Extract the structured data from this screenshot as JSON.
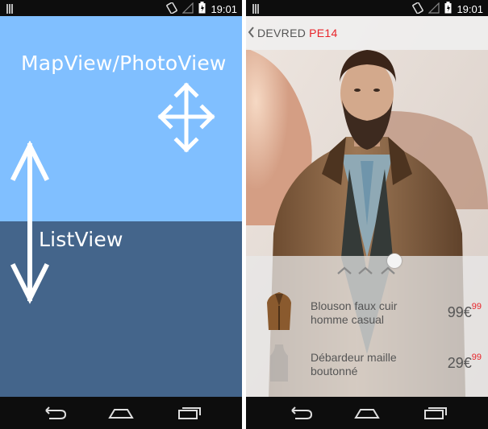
{
  "status_bar": {
    "time": "19:01"
  },
  "left_screen": {
    "top_label": "MapView/PhotoView",
    "bottom_label": "ListView"
  },
  "right_screen": {
    "action_bar": {
      "brand": "DEVRED",
      "code": "PE14"
    },
    "products": [
      {
        "name_line1": "Blouson faux cuir",
        "name_line2": "homme casual",
        "price_main": "99€",
        "price_cents": "99"
      },
      {
        "name_line1": "Débardeur maille",
        "name_line2": "boutonné",
        "price_main": "29€",
        "price_cents": "99"
      }
    ]
  },
  "colors": {
    "photo_view_bg": "#80bfff",
    "list_view_bg": "#44658b",
    "accent_red": "#e8242a"
  },
  "icons": {
    "status_left": "signal-icon",
    "status_right": [
      "screen-rotation-icon",
      "no-signal-icon",
      "battery-charging-icon"
    ],
    "nav": [
      "back-icon",
      "home-icon",
      "recent-apps-icon"
    ]
  }
}
